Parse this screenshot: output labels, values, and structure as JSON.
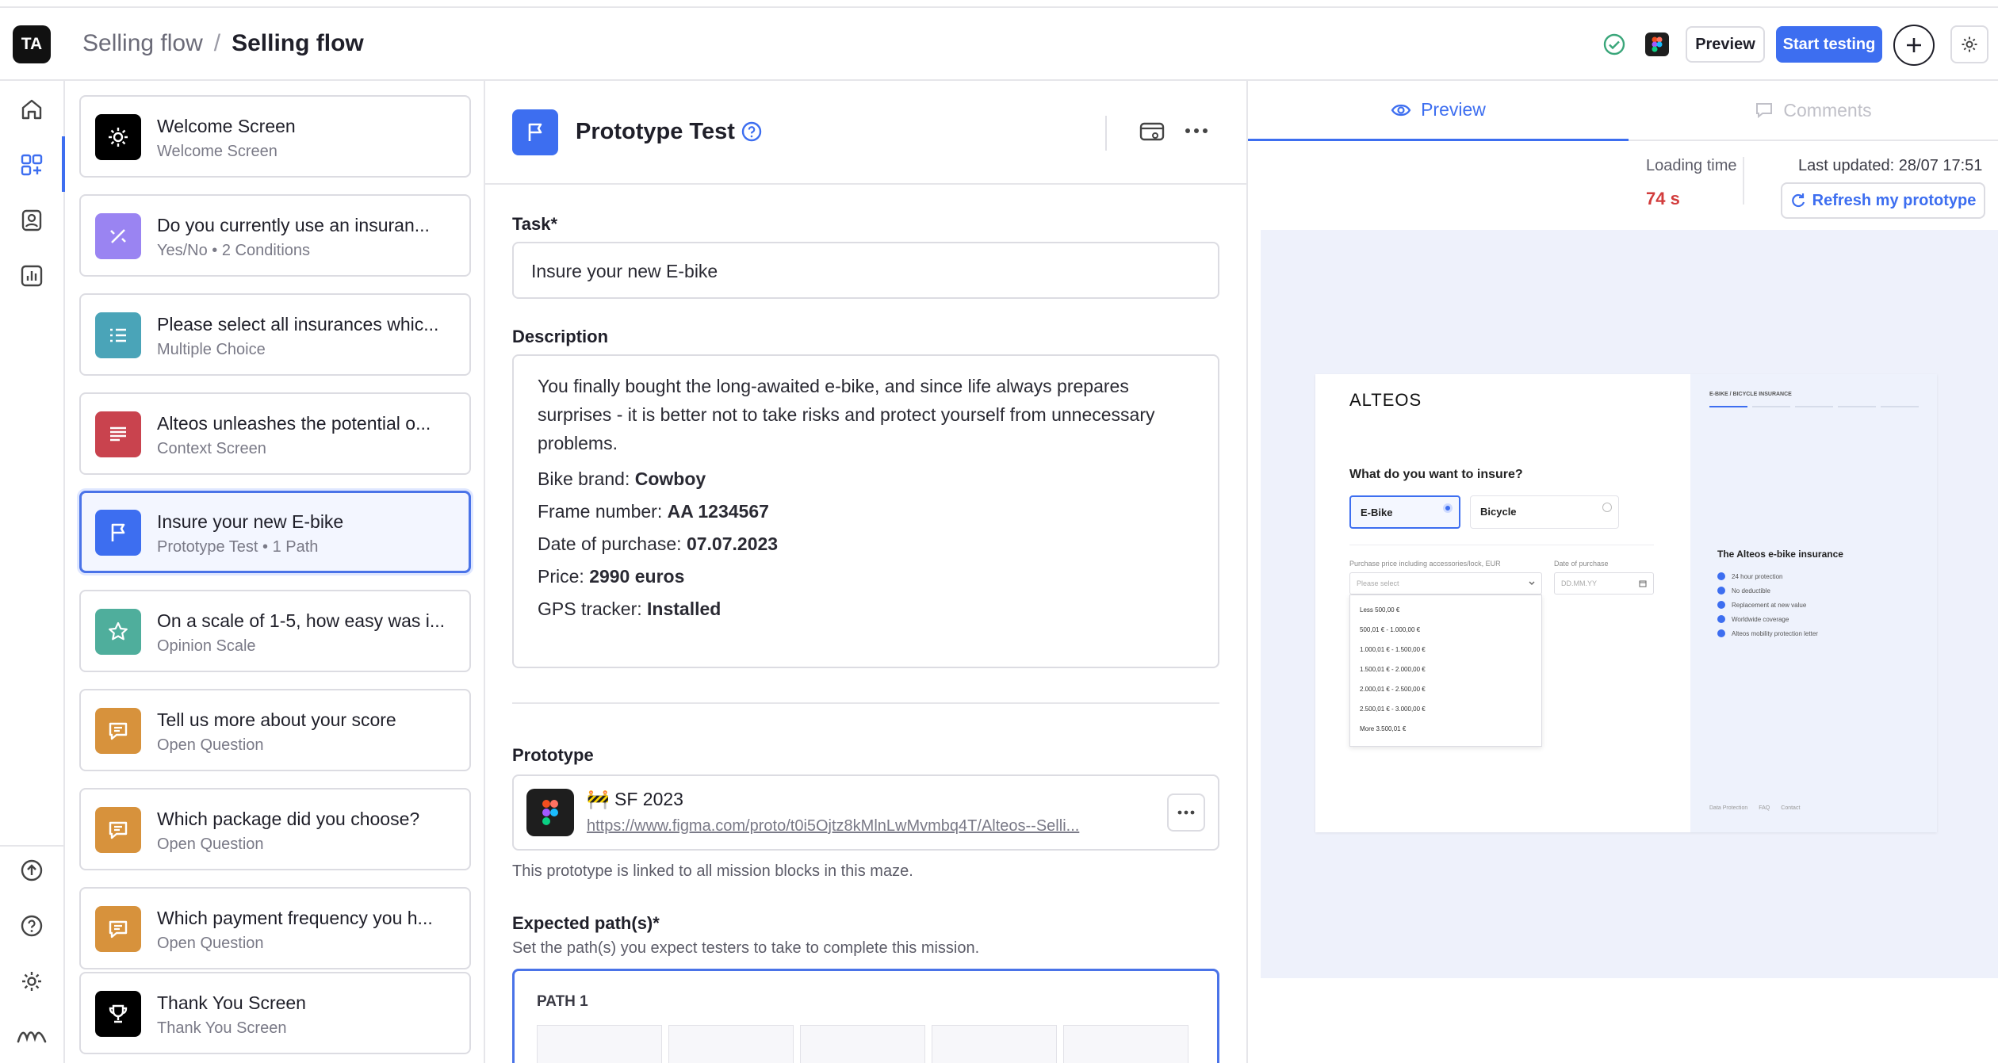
{
  "app": {
    "logo_initials": "TA"
  },
  "breadcrumb": {
    "parent": "Selling flow",
    "separator": "/",
    "current": "Selling flow"
  },
  "header": {
    "preview_label": "Preview",
    "start_label": "Start testing"
  },
  "blocks": [
    {
      "title": "Welcome Screen",
      "subtitle": "Welcome Screen",
      "color": "#000000",
      "icon": "sun-icon"
    },
    {
      "title": "Do you currently use an insuran...",
      "subtitle": "Yes/No • 2 Conditions",
      "color": "#9a84f2",
      "icon": "percent-icon"
    },
    {
      "title": "Please select all insurances whic...",
      "subtitle": "Multiple Choice",
      "color": "#4aa4b8",
      "icon": "list-icon"
    },
    {
      "title": "Alteos unleashes the potential o...",
      "subtitle": "Context Screen",
      "color": "#c9434e",
      "icon": "text-lines-icon"
    },
    {
      "title": "Insure your new E-bike",
      "subtitle": "Prototype Test • 1 Path",
      "color": "#3d6ef0",
      "icon": "flag-icon"
    },
    {
      "title": "On a scale of 1-5, how easy was i...",
      "subtitle": "Opinion Scale",
      "color": "#4fae9c",
      "icon": "star-icon"
    },
    {
      "title": "Tell us more about your score",
      "subtitle": "Open Question",
      "color": "#d7923c",
      "icon": "chat-icon"
    },
    {
      "title": "Which package did you choose?",
      "subtitle": "Open Question",
      "color": "#d7923c",
      "icon": "chat-icon"
    },
    {
      "title": "Which payment frequency you h...",
      "subtitle": "Open Question",
      "color": "#d7923c",
      "icon": "chat-icon"
    },
    {
      "title": "Thank You Screen",
      "subtitle": "Thank You Screen",
      "color": "#000000",
      "icon": "trophy-icon"
    }
  ],
  "editor": {
    "block_type": "Prototype Test",
    "task_label": "Task*",
    "task_value": "Insure your new E-bike",
    "description_label": "Description",
    "description_text": "You finally bought the long-awaited e-bike, and since life always prepares surprises - it is better not to take risks and protect yourself from unnecessary problems.",
    "details": [
      {
        "key": "Bike brand: ",
        "value": "Cowboy"
      },
      {
        "key": "Frame number: ",
        "value": "AA 1234567"
      },
      {
        "key": "Date of purchase: ",
        "value": "07.07.2023"
      },
      {
        "key": "Price: ",
        "value": "2990 euros"
      },
      {
        "key": "GPS tracker: ",
        "value": "Installed"
      }
    ],
    "prototype_label": "Prototype",
    "prototype_name": "🚧 SF 2023",
    "prototype_url": "https://www.figma.com/proto/t0i5Ojtz8kMlnLwMvmbq4T/Alteos--Selli...",
    "prototype_note": "This prototype is linked to all mission blocks in this maze.",
    "paths_label": "Expected path(s)*",
    "paths_hint": "Set the path(s) you expect testers to take to complete this mission.",
    "path_title": "PATH 1"
  },
  "preview_panel": {
    "tab_preview": "Preview",
    "tab_comments": "Comments",
    "loading_label": "Loading time",
    "loading_value": "74 s",
    "updated_label": "Last updated: 28/07 17:51",
    "refresh_label": "Refresh my prototype"
  },
  "prototype_screen": {
    "brand": "ALTEOS",
    "progress_label": "E-BIKE / BICYCLE INSURANCE",
    "question": "What do you want to insure?",
    "option_ebike": "E-Bike",
    "option_bicycle": "Bicycle",
    "price_label": "Purchase price including accessories/lock, EUR",
    "date_label": "Date of purchase",
    "select_placeholder": "Please select",
    "date_placeholder": "DD.MM.YY",
    "price_options": [
      "Less 500,00 €",
      "500,01 € - 1.000,00 €",
      "1.000,01 € - 1.500,00 €",
      "1.500,01 € - 2.000,00 €",
      "2.000,01 € - 2.500,00 €",
      "2.500,01 € - 3.000,00 €",
      "More 3.500,01 €"
    ],
    "features_title": "The Alteos e-bike insurance",
    "features": [
      "24 hour protection",
      "No deductible",
      "Replacement at new value",
      "Worldwide coverage",
      "Alteos mobility protection letter"
    ],
    "footer_links": [
      "Data Protection",
      "FAQ",
      "Contact"
    ]
  },
  "colors": {
    "accent": "#3d6ef0",
    "loading": "#d23c3c",
    "preview_bg": "#eef1fb"
  }
}
